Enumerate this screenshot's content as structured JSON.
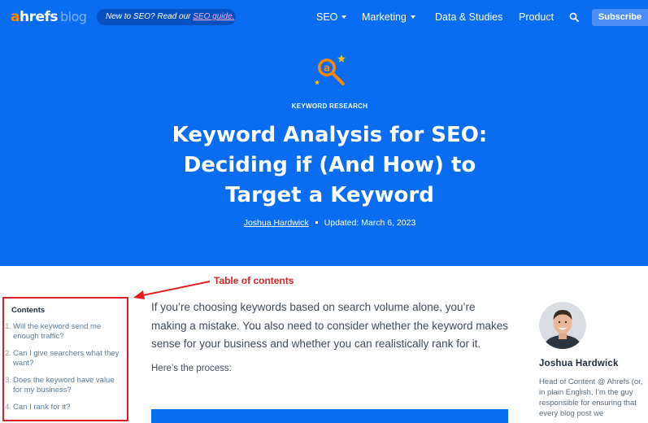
{
  "nav": {
    "logo_a": "a",
    "logo_rest": "hrefs",
    "logo_blog": "blog",
    "promo_text": "New to SEO? Read our ",
    "promo_link": "SEO guide.",
    "items": [
      {
        "label": "SEO",
        "dropdown": true
      },
      {
        "label": "Marketing",
        "dropdown": true
      },
      {
        "label": "Data & Studies",
        "dropdown": false
      },
      {
        "label": "Product",
        "dropdown": false
      }
    ],
    "subscribe_label": "Subscribe",
    "search_icon": "search-icon"
  },
  "hero": {
    "category_icon": "magnifier-star-icon",
    "category": "KEYWORD RESEARCH",
    "title_line1": "Keyword Analysis for SEO:",
    "title_line2": "Deciding if (And How) to",
    "title_line3": "Target a Keyword",
    "author": "Joshua Hardwick",
    "updated": "Updated: March 6, 2023"
  },
  "annotation": {
    "label": "Table of contents"
  },
  "toc": {
    "heading": "Contents",
    "items": [
      {
        "num": "1.",
        "text": "Will the keyword send me enough traffic?"
      },
      {
        "num": "2.",
        "text": "Can I give searchers what they want?"
      },
      {
        "num": "3.",
        "text": "Does the keyword have value for my business?"
      },
      {
        "num": "4.",
        "text": "Can I rank for it?"
      }
    ]
  },
  "article": {
    "intro": "If you’re choosing keywords based on search volume alone, you’re making a mistake. You also need to consider whether the keyword makes sense for your business and whether you can realistically rank for it.",
    "process": "Here’s the process:"
  },
  "author_card": {
    "name": "Joshua Hardwick",
    "bio": "Head of Content @ Ahrefs (or, in plain English, I’m the guy responsible for ensuring that every blog post we"
  },
  "colors": {
    "hero_bg": "#0a6cf0",
    "logo_accent": "#ff8800",
    "annotation_red": "#e02020",
    "subscribe_bg": "#4d8ff5"
  }
}
